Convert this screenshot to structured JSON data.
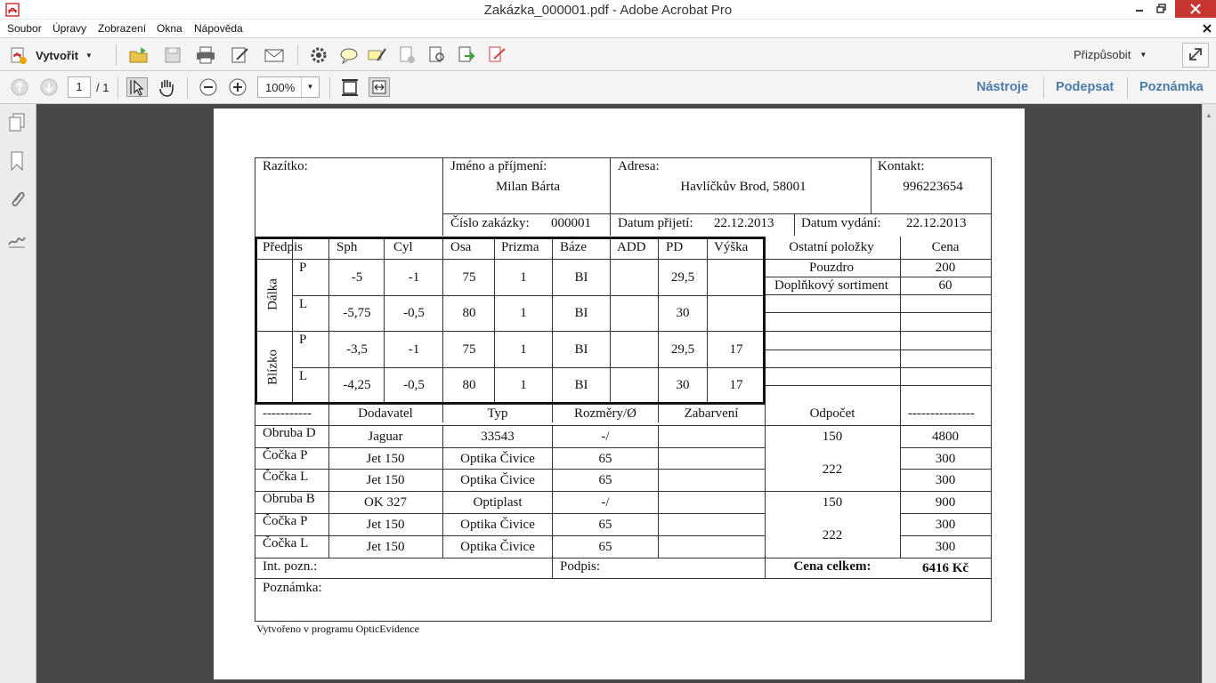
{
  "window": {
    "title": "Zakázka_000001.pdf - Adobe Acrobat Pro"
  },
  "menu": [
    "Soubor",
    "Úpravy",
    "Zobrazení",
    "Okna",
    "Nápověda"
  ],
  "toolbar": {
    "create_label": "Vytvořit",
    "customize_label": "Přizpůsobit"
  },
  "nav": {
    "page_value": "1",
    "page_total": "/ 1",
    "zoom": "100%"
  },
  "tabs": {
    "tools": "Nástroje",
    "sign": "Podepsat",
    "comment": "Poznámka"
  },
  "doc": {
    "stamp_label": "Razítko:",
    "name_label": "Jméno a příjmení:",
    "name_value": "Milan Bárta",
    "address_label": "Adresa:",
    "address_value": "Havlíčkův Brod, 58001",
    "contact_label": "Kontakt:",
    "contact_value": "996223654",
    "order_label": "Číslo zakázky:",
    "order_value": "000001",
    "received_label": "Datum přijetí:",
    "received_value": "22.12.2013",
    "issued_label": "Datum vydání:",
    "issued_value": "22.12.2013",
    "rx_headers": [
      "Předpis",
      "Sph",
      "Cyl",
      "Osa",
      "Prizma",
      "Báze",
      "ADD",
      "PD",
      "Výška"
    ],
    "rx_groups": [
      "Dálka",
      "Blízko"
    ],
    "rx_rows": [
      {
        "eye": "P",
        "sph": "-5",
        "cyl": "-1",
        "osa": "75",
        "prizma": "1",
        "baze": "BI",
        "add": "",
        "pd": "29,5",
        "vyska": ""
      },
      {
        "eye": "L",
        "sph": "-5,75",
        "cyl": "-0,5",
        "osa": "80",
        "prizma": "1",
        "baze": "BI",
        "add": "",
        "pd": "30",
        "vyska": ""
      },
      {
        "eye": "P",
        "sph": "-3,5",
        "cyl": "-1",
        "osa": "75",
        "prizma": "1",
        "baze": "BI",
        "add": "",
        "pd": "29,5",
        "vyska": "17"
      },
      {
        "eye": "L",
        "sph": "-4,25",
        "cyl": "-0,5",
        "osa": "80",
        "prizma": "1",
        "baze": "BI",
        "add": "",
        "pd": "30",
        "vyska": "17"
      }
    ],
    "other_header": "Ostatní položky",
    "price_header": "Cena",
    "other_items": [
      {
        "name": "Pouzdro",
        "price": "200"
      },
      {
        "name": "Doplňkový sortiment",
        "price": "60"
      }
    ],
    "items_headers": [
      "-----------",
      "Dodavatel",
      "Typ",
      "Rozměry/Ø",
      "Zabarvení",
      "Odpočet",
      "---------------"
    ],
    "items": [
      {
        "label": "Obruba D",
        "supplier": "Jaguar",
        "type": "33543",
        "size": "-/",
        "color": "",
        "price": "4800"
      },
      {
        "label": "Čočka P",
        "supplier": "Jet 150",
        "type": "Optika Čivice",
        "size": "65",
        "color": "",
        "price": "300"
      },
      {
        "label": "Čočka L",
        "supplier": "Jet 150",
        "type": "Optika Čivice",
        "size": "65",
        "color": "",
        "price": "300"
      },
      {
        "label": "Obruba B",
        "supplier": "OK 327",
        "type": "Optiplast",
        "size": "-/",
        "color": "",
        "price": "900"
      },
      {
        "label": "Čočka P",
        "supplier": "Jet 150",
        "type": "Optika Čivice",
        "size": "65",
        "color": "",
        "price": "300"
      },
      {
        "label": "Čočka L",
        "supplier": "Jet 150",
        "type": "Optika Čivice",
        "size": "65",
        "color": "",
        "price": "300"
      }
    ],
    "deductions": [
      "150",
      "222",
      "150",
      "222"
    ],
    "int_note_label": "Int. pozn.:",
    "signature_label": "Podpis:",
    "total_label": "Cena celkem:",
    "total_value": "6416 Kč",
    "note_label": "Poznámka:",
    "footer": "Vytvořeno v programu OpticEvidence"
  }
}
